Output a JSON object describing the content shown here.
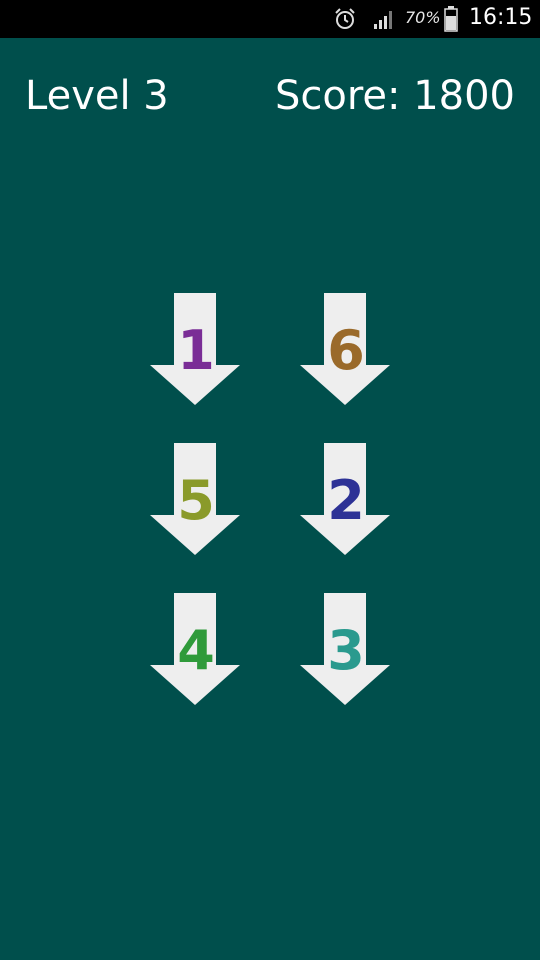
{
  "status_bar": {
    "battery_percent": "70%",
    "time": "16:15",
    "icons": [
      "alarm-icon",
      "signal-icon",
      "battery-icon"
    ]
  },
  "hud": {
    "level": "Level 3",
    "score": "Score: 1800"
  },
  "tiles": [
    {
      "number": "1",
      "color": "#7a2d96"
    },
    {
      "number": "6",
      "color": "#9a6a2a"
    },
    {
      "number": "5",
      "color": "#8a9a2a"
    },
    {
      "number": "2",
      "color": "#2d3296"
    },
    {
      "number": "4",
      "color": "#2f9a3a"
    },
    {
      "number": "3",
      "color": "#2a9a8e"
    }
  ],
  "colors": {
    "background": "#004f4c",
    "arrow": "#eeeeee",
    "status_bar": "#000000"
  }
}
